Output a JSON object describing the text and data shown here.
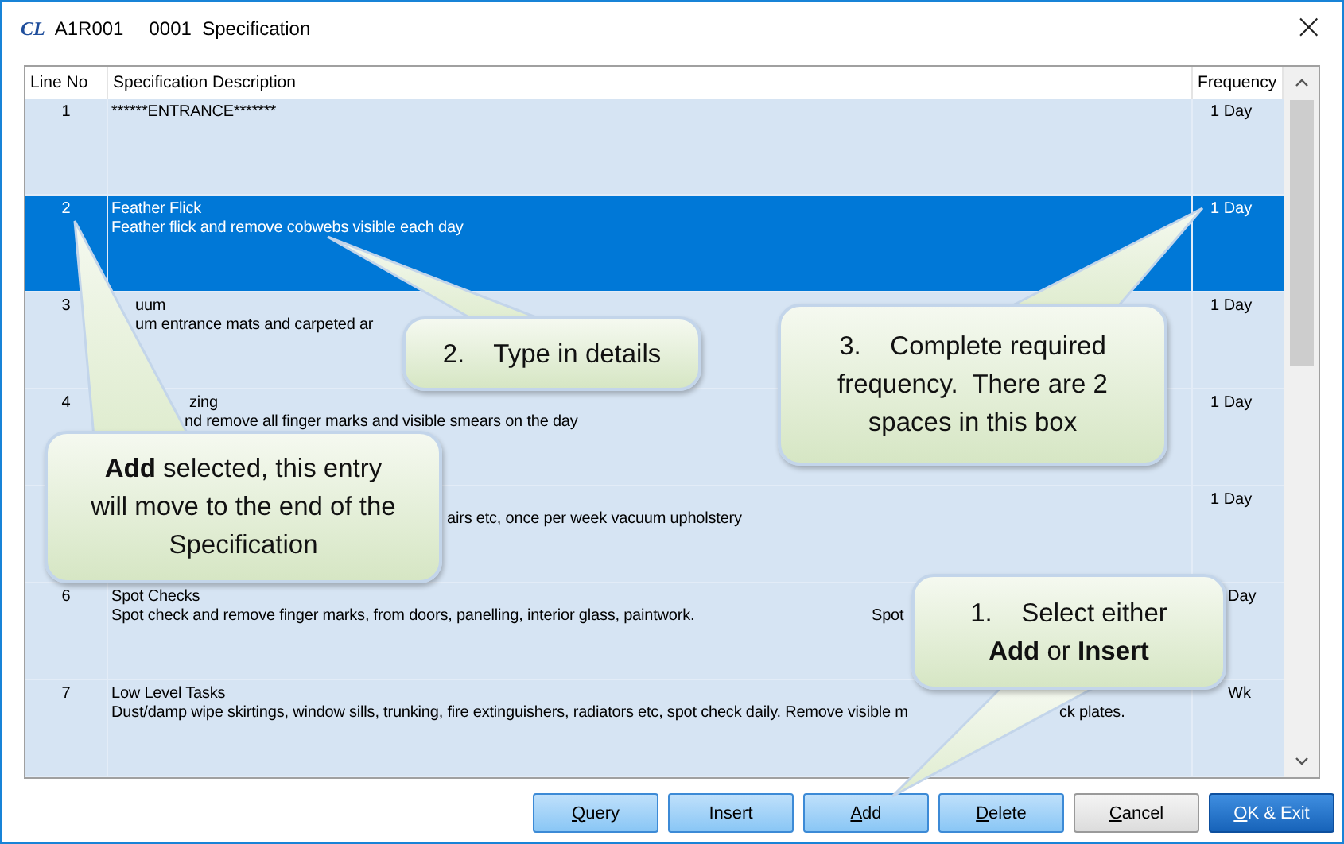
{
  "window": {
    "logo": "CL",
    "code": "A1R001",
    "title": "0001  Specification",
    "close": "×"
  },
  "table": {
    "columns": [
      "Line No",
      "Specification Description",
      "Frequency"
    ],
    "rows": [
      {
        "line_no": "1",
        "title": [
          "******ENTRANCE*******"
        ],
        "frequency": "1 Day",
        "selected": false
      },
      {
        "line_no": "2",
        "title": [
          "Feather Flick"
        ],
        "description": [
          "Feather flick and remove cobwebs visible each day"
        ],
        "frequency": "1 Day",
        "selected": true
      },
      {
        "line_no": "3",
        "title": [
          "uum"
        ],
        "description": [
          "um entrance mats and carpeted ar"
        ],
        "frequency": "1 Day",
        "selected": false
      },
      {
        "line_no": "4",
        "title": [
          "zing"
        ],
        "description": [
          "nd remove all finger marks and visible smears on the day"
        ],
        "frequency": "1 Day",
        "selected": false
      },
      {
        "description": [
          "airs etc, once per week vacuum upholstery"
        ],
        "frequency": "1 Day",
        "selected": false
      },
      {
        "line_no": "6",
        "title": [
          "Spot Checks"
        ],
        "description": [
          "Spot check and remove finger marks, from doors, panelling, interior glass, paintwork.",
          "Spot"
        ],
        "frequency": "Day",
        "selected": false
      },
      {
        "line_no": "7",
        "title": [
          "Low Level Tasks"
        ],
        "description": [
          "Dust/damp wipe skirtings, window sills, trunking, fire extinguishers, radiators etc, spot check daily. Remove visible m",
          "ck plates."
        ],
        "frequency": "Wk",
        "selected": false
      }
    ]
  },
  "callouts": [
    {
      "text": "**Add** selected, this entry will move to the end of the Specification"
    },
    {
      "text": "2.    Type in details"
    },
    {
      "text": "3.    Complete required frequency.  There are 2 spaces in this box"
    },
    {
      "text": "1.    Select either **Add** or **Insert**"
    }
  ],
  "buttons": [
    {
      "label": "Query",
      "mnemonic": true,
      "kind": "normal"
    },
    {
      "label": "Insert",
      "mnemonic": false,
      "kind": "normal"
    },
    {
      "label": "Add",
      "mnemonic": true,
      "kind": "normal"
    },
    {
      "label": "Delete",
      "mnemonic": true,
      "kind": "normal"
    },
    {
      "label": "Cancel",
      "mnemonic": true,
      "kind": "neutral"
    },
    {
      "label": "OK & Exit",
      "mnemonic": true,
      "kind": "primary"
    }
  ]
}
